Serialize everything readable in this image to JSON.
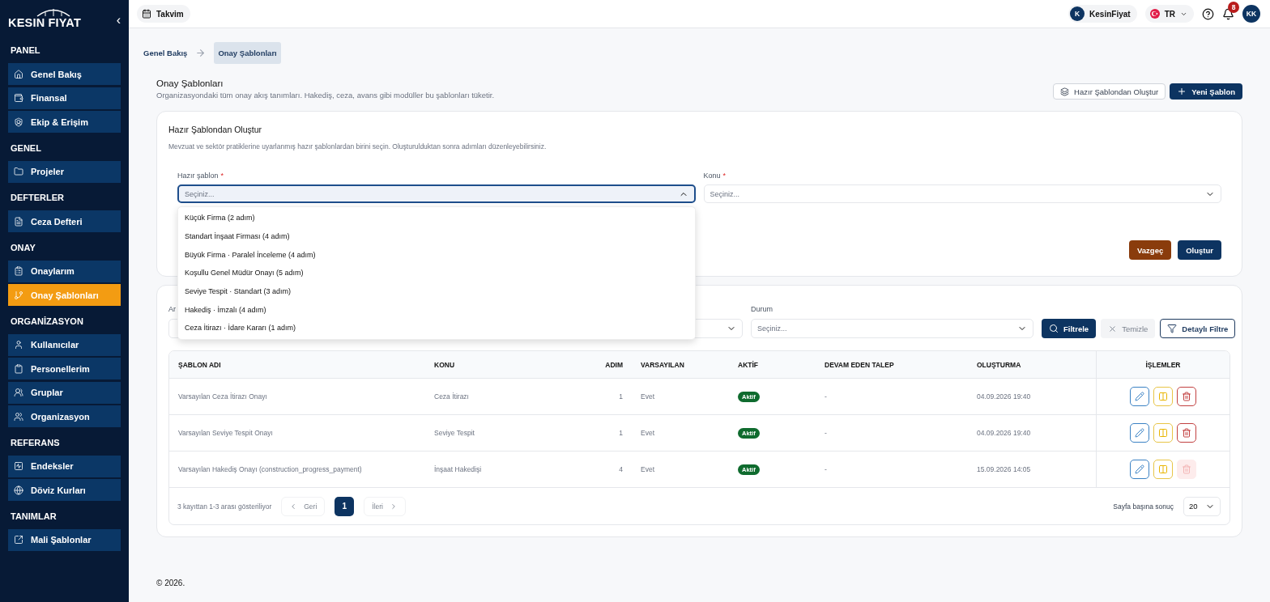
{
  "sidebar": {
    "logo": "KESIN FIYAT",
    "collapse": "‹",
    "sections": [
      {
        "title": "PANEL",
        "items": [
          {
            "label": "Genel Bakış",
            "selected": false
          },
          {
            "label": "Finansal",
            "selected": false
          },
          {
            "label": "Ekip & Erişim",
            "selected": false
          }
        ]
      },
      {
        "title": "GENEL",
        "items": [
          {
            "label": "Projeler",
            "selected": false
          }
        ]
      },
      {
        "title": "DEFTERLER",
        "items": [
          {
            "label": "Ceza Defteri",
            "selected": false
          }
        ]
      },
      {
        "title": "ONAY",
        "items": [
          {
            "label": "Onaylarım",
            "selected": false
          },
          {
            "label": "Onay Şablonları",
            "selected": true
          }
        ]
      },
      {
        "title": "ORGANİZASYON",
        "items": [
          {
            "label": "Kullanıcılar",
            "selected": false
          },
          {
            "label": "Personellerim",
            "selected": false
          },
          {
            "label": "Gruplar",
            "selected": false
          },
          {
            "label": "Organizasyon",
            "selected": false
          }
        ]
      },
      {
        "title": "REFERANS",
        "items": [
          {
            "label": "Endeksler",
            "selected": false
          },
          {
            "label": "Döviz Kurları",
            "selected": false
          }
        ]
      },
      {
        "title": "TANIMLAR",
        "items": [
          {
            "label": "Mali Şablonlar",
            "selected": false
          }
        ]
      }
    ]
  },
  "topbar": {
    "calendar": "Takvim",
    "account_initial": "K",
    "account": "KesinFiyat",
    "language": "TR",
    "notifications": "8",
    "user_initials": "KK"
  },
  "breadcrumb": [
    {
      "label": "Genel Bakış",
      "selected": false
    },
    {
      "label": "Onay Şablonları",
      "selected": true
    }
  ],
  "page": {
    "title": "Onay Şablonları",
    "description": "Organizasyondaki tüm onay akış tanımları. Hakediş, ceza, avans gibi modüller bu şablonları tüketir.",
    "actions": [
      {
        "kind": "outline",
        "label": "Hazır Şablondan Oluştur"
      },
      {
        "kind": "primary",
        "label": "Yeni Şablon"
      }
    ]
  },
  "create_panel": {
    "title": "Hazır Şablondan Oluştur",
    "description": "Mevzuat ve sektör pratiklerine uyarlanmış hazır şablonlardan birini seçin. Oluşturulduktan sonra adımları düzenleyebilirsiniz.",
    "fields": [
      {
        "label": "Hazır şablon",
        "required_mark": "*",
        "placeholder": "Seçiniz...",
        "expanded": true,
        "options": [
          {
            "label": "Küçük Firma (2 adım)",
            "selected": false
          },
          {
            "label": "Standart İnşaat Firması (4 adım)",
            "selected": false
          },
          {
            "label": "Büyük Firma · Paralel İnceleme (4 adım)",
            "selected": false
          },
          {
            "label": "Koşullu Genel Müdür Onayı (5 adım)",
            "selected": false
          },
          {
            "label": "Seviye Tespit · Standart (3 adım)",
            "selected": false
          },
          {
            "label": "Hakediş · İmzalı (4 adım)",
            "selected": false
          },
          {
            "label": "Ceza İtirazı · İdare Kararı (1 adım)",
            "selected": false
          }
        ]
      },
      {
        "label": "Konu",
        "required_mark": "*",
        "placeholder": "Seçiniz...",
        "expanded": false
      }
    ],
    "buttons": [
      {
        "kind": "cancel",
        "label": "Vazgeç"
      },
      {
        "kind": "primary",
        "label": "Oluştur"
      }
    ]
  },
  "filters": {
    "fields": [
      {
        "kind": "text",
        "label": "Ar"
      },
      {
        "kind": "select"
      },
      {
        "kind": "select",
        "label": "Durum",
        "placeholder": "Seçiniz..."
      }
    ],
    "buttons": [
      {
        "kind": "primary",
        "label": "Filtrele",
        "disabled": false
      },
      {
        "kind": "clear",
        "label": "Temizle",
        "disabled": true
      },
      {
        "kind": "outline",
        "label": "Detaylı Filtre",
        "disabled": false
      }
    ]
  },
  "table": {
    "columns": [
      "ŞABLON ADI",
      "KONU",
      "ADIM",
      "VARSAYILAN",
      "AKTİF",
      "DEVAM EDEN TALEP",
      "OLUŞTURMA",
      "İŞLEMLER"
    ],
    "rows": [
      {
        "name": "Varsayılan Ceza İtirazı Onayı",
        "subject": "Ceza İtirazı",
        "steps": "1",
        "default": "Evet",
        "status": "Aktif",
        "pending": "-",
        "created": "04.09.2026 19:40",
        "actions": [
          {
            "kind": "edit",
            "disabled": false
          },
          {
            "kind": "pause",
            "disabled": false
          },
          {
            "kind": "delete",
            "disabled": false
          }
        ]
      },
      {
        "name": "Varsayılan Seviye Tespit Onayı",
        "subject": "Seviye Tespit",
        "steps": "1",
        "default": "Evet",
        "status": "Aktif",
        "pending": "-",
        "created": "04.09.2026 19:40",
        "actions": [
          {
            "kind": "edit",
            "disabled": false
          },
          {
            "kind": "pause",
            "disabled": false
          },
          {
            "kind": "delete",
            "disabled": false
          }
        ]
      },
      {
        "name": "Varsayılan Hakediş Onayı (construction_progress_payment)",
        "subject": "İnşaat Hakedişi",
        "steps": "4",
        "default": "Evet",
        "status": "Aktif",
        "pending": "-",
        "created": "15.09.2026 14:05",
        "actions": [
          {
            "kind": "edit",
            "disabled": false
          },
          {
            "kind": "pause",
            "disabled": false
          },
          {
            "kind": "delete",
            "disabled": true
          }
        ]
      }
    ]
  },
  "pagination": {
    "summary": "3 kayıttan 1-3 arası gösteriliyor",
    "prev": {
      "label": "Geri",
      "disabled": true
    },
    "pages": [
      {
        "label": "1",
        "selected": true
      }
    ],
    "next": {
      "label": "İleri",
      "disabled": true
    },
    "page_size_label": "Sayfa başına sonuç",
    "page_size": "20"
  },
  "footer": "© 2026."
}
